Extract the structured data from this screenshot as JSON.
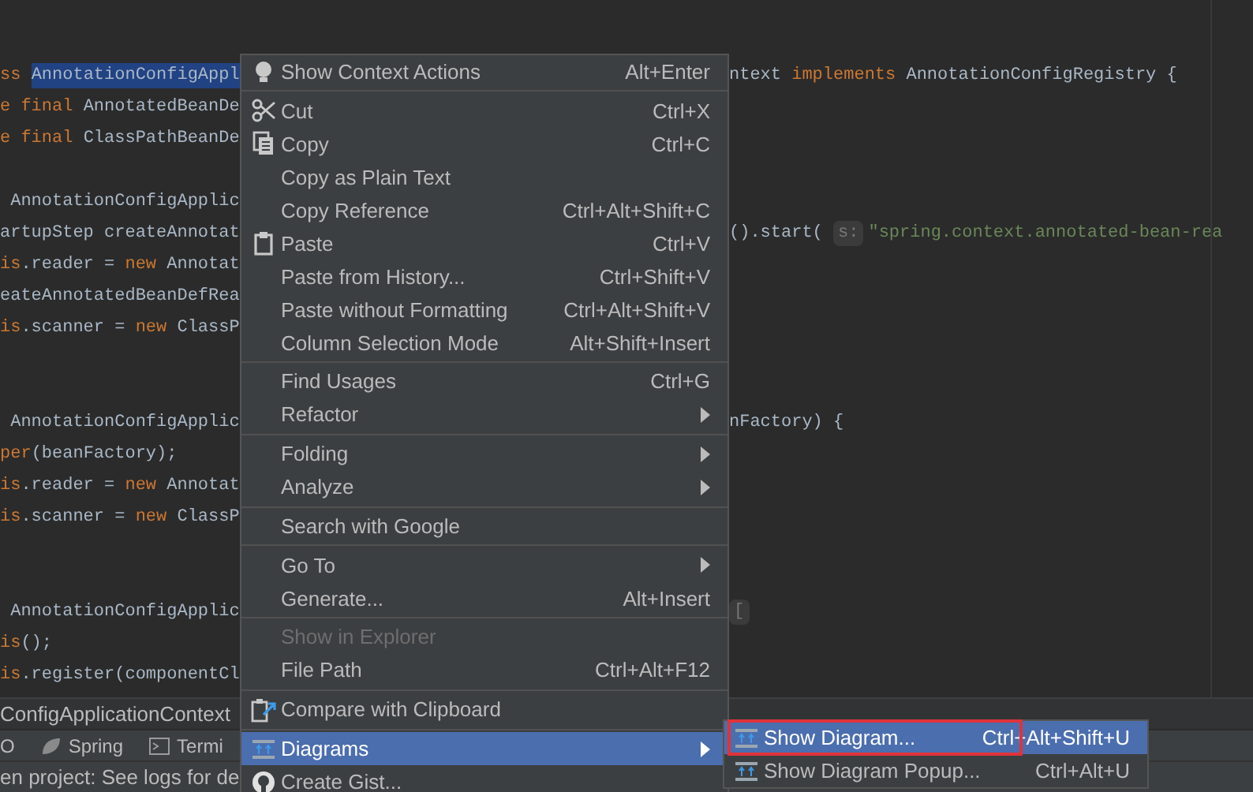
{
  "editor": {
    "lines": [
      {
        "kind": "spaced",
        "left": [
          {
            "kind": "keyword",
            "text": "ss "
          },
          {
            "kind": "selected",
            "text": "AnnotationConfigAppl"
          }
        ],
        "right": [
          {
            "kind": "plain",
            "text": "ntext "
          },
          {
            "kind": "keyword",
            "text": "implements "
          },
          {
            "kind": "plain",
            "text": "AnnotationConfigRegistry {"
          }
        ]
      },
      {
        "kind": "line",
        "left": [
          {
            "kind": "keyword",
            "text": "e final "
          },
          {
            "kind": "plain",
            "text": "AnnotatedBeanDe"
          }
        ]
      },
      {
        "kind": "line",
        "left": [
          {
            "kind": "keyword",
            "text": "e final "
          },
          {
            "kind": "plain",
            "text": "ClassPathBeanDe"
          }
        ]
      },
      {
        "kind": "spaced",
        "left": [
          {
            "kind": "plain",
            "text": " AnnotationConfigApplic"
          }
        ]
      },
      {
        "kind": "line",
        "left": [
          {
            "kind": "plain",
            "text": "artupStep createAnnotat"
          }
        ],
        "right": [
          {
            "kind": "plain",
            "text": "().start( "
          },
          {
            "kind": "hint",
            "text": "s:"
          },
          {
            "kind": "string",
            "text": "\"spring.context.annotated-bean-rea"
          }
        ]
      },
      {
        "kind": "line",
        "left": [
          {
            "kind": "keyword",
            "text": "is"
          },
          {
            "kind": "plain",
            "text": ".reader = "
          },
          {
            "kind": "keyword",
            "text": "new "
          },
          {
            "kind": "plain",
            "text": "Annotat"
          }
        ]
      },
      {
        "kind": "line",
        "left": [
          {
            "kind": "plain",
            "text": "eateAnnotatedBeanDefRea"
          }
        ]
      },
      {
        "kind": "line",
        "left": [
          {
            "kind": "keyword",
            "text": "is"
          },
          {
            "kind": "plain",
            "text": ".scanner = "
          },
          {
            "kind": "keyword",
            "text": "new "
          },
          {
            "kind": "plain",
            "text": "ClassP"
          }
        ]
      },
      {
        "kind": "block",
        "left": [
          {
            "kind": "plain",
            "text": " AnnotationConfigApplic"
          }
        ],
        "right": [
          {
            "kind": "plain",
            "text": "nFactory) {"
          }
        ]
      },
      {
        "kind": "line",
        "left": [
          {
            "kind": "keyword",
            "text": "per"
          },
          {
            "kind": "plain",
            "text": "(beanFactory);"
          }
        ]
      },
      {
        "kind": "line",
        "left": [
          {
            "kind": "keyword",
            "text": "is"
          },
          {
            "kind": "plain",
            "text": ".reader = "
          },
          {
            "kind": "keyword",
            "text": "new "
          },
          {
            "kind": "plain",
            "text": "Annotat"
          }
        ]
      },
      {
        "kind": "line",
        "left": [
          {
            "kind": "keyword",
            "text": "is"
          },
          {
            "kind": "plain",
            "text": ".scanner = "
          },
          {
            "kind": "keyword",
            "text": "new "
          },
          {
            "kind": "plain",
            "text": "ClassP"
          }
        ]
      },
      {
        "kind": "block",
        "left": [
          {
            "kind": "plain",
            "text": " AnnotationConfigApplic"
          }
        ],
        "right": [
          {
            "kind": "hint",
            "text": "["
          }
        ]
      },
      {
        "kind": "line",
        "left": [
          {
            "kind": "keyword",
            "text": "is"
          },
          {
            "kind": "plain",
            "text": "();"
          }
        ]
      },
      {
        "kind": "line",
        "left": [
          {
            "kind": "keyword",
            "text": "is"
          },
          {
            "kind": "plain",
            "text": ".register(componentCl"
          }
        ]
      }
    ]
  },
  "breadcrumb": "ConfigApplicationContext",
  "tool_tabs": [
    {
      "label": "O"
    },
    {
      "label": "Spring"
    },
    {
      "label": "Termi"
    }
  ],
  "status_bar": "en project: See logs for de",
  "context_menu": [
    {
      "kind": "item",
      "label": "Show Context Actions",
      "shortcut": "Alt+Enter",
      "has_submenu": false,
      "disabled": false,
      "selected": false
    },
    {
      "kind": "separator"
    },
    {
      "kind": "item",
      "label": "Cut",
      "shortcut": "Ctrl+X",
      "has_submenu": false,
      "disabled": false,
      "selected": false
    },
    {
      "kind": "item",
      "label": "Copy",
      "shortcut": "Ctrl+C",
      "has_submenu": false,
      "disabled": false,
      "selected": false
    },
    {
      "kind": "item",
      "label": "Copy as Plain Text",
      "has_submenu": false,
      "disabled": false,
      "selected": false
    },
    {
      "kind": "item",
      "label": "Copy Reference",
      "shortcut": "Ctrl+Alt+Shift+C",
      "has_submenu": false,
      "disabled": false,
      "selected": false
    },
    {
      "kind": "item",
      "label": "Paste",
      "shortcut": "Ctrl+V",
      "has_submenu": false,
      "disabled": false,
      "selected": false
    },
    {
      "kind": "item",
      "label": "Paste from History...",
      "shortcut": "Ctrl+Shift+V",
      "has_submenu": false,
      "disabled": false,
      "selected": false
    },
    {
      "kind": "item",
      "label": "Paste without Formatting",
      "shortcut": "Ctrl+Alt+Shift+V",
      "has_submenu": false,
      "disabled": false,
      "selected": false
    },
    {
      "kind": "item",
      "label": "Column Selection Mode",
      "shortcut": "Alt+Shift+Insert",
      "has_submenu": false,
      "disabled": false,
      "selected": false
    },
    {
      "kind": "separator"
    },
    {
      "kind": "item",
      "label": "Find Usages",
      "shortcut": "Ctrl+G",
      "has_submenu": false,
      "disabled": false,
      "selected": false
    },
    {
      "kind": "item",
      "label": "Refactor",
      "has_submenu": true,
      "disabled": false,
      "selected": false
    },
    {
      "kind": "separator"
    },
    {
      "kind": "item",
      "label": "Folding",
      "has_submenu": true,
      "disabled": false,
      "selected": false
    },
    {
      "kind": "item",
      "label": "Analyze",
      "has_submenu": true,
      "disabled": false,
      "selected": false
    },
    {
      "kind": "separator"
    },
    {
      "kind": "item",
      "label": "Search with Google",
      "has_submenu": false,
      "disabled": false,
      "selected": false
    },
    {
      "kind": "separator"
    },
    {
      "kind": "item",
      "label": "Go To",
      "has_submenu": true,
      "disabled": false,
      "selected": false
    },
    {
      "kind": "item",
      "label": "Generate...",
      "shortcut": "Alt+Insert",
      "has_submenu": false,
      "disabled": false,
      "selected": false
    },
    {
      "kind": "separator"
    },
    {
      "kind": "item",
      "label": "Show in Explorer",
      "has_submenu": false,
      "disabled": true,
      "selected": false
    },
    {
      "kind": "item",
      "label": "File Path",
      "shortcut": "Ctrl+Alt+F12",
      "has_submenu": false,
      "disabled": false,
      "selected": false
    },
    {
      "kind": "separator"
    },
    {
      "kind": "item",
      "label": "Compare with Clipboard",
      "has_submenu": false,
      "disabled": false,
      "selected": false
    },
    {
      "kind": "separator"
    },
    {
      "kind": "item",
      "label": "Diagrams",
      "has_submenu": true,
      "disabled": false,
      "selected": true
    },
    {
      "kind": "item",
      "label": "Create Gist...",
      "has_submenu": false,
      "disabled": false,
      "selected": false
    }
  ],
  "submenu": [
    {
      "label": "Show Diagram...",
      "shortcut": "Ctrl+Alt+Shift+U",
      "selected": true,
      "highlighted": true
    },
    {
      "label": "Show Diagram Popup...",
      "shortcut": "Ctrl+Alt+U",
      "selected": false,
      "highlighted": false
    }
  ]
}
